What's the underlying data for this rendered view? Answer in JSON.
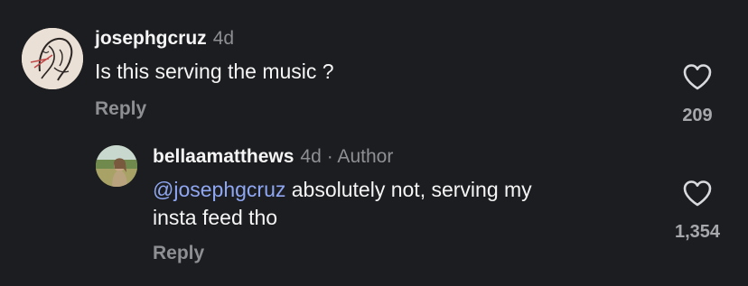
{
  "comments": [
    {
      "username": "josephgcruz",
      "time": "4d",
      "author_tag": "",
      "mention": "",
      "text": "Is this serving the music ?",
      "reply_label": "Reply",
      "likes": "209"
    },
    {
      "username": "bellaamatthews",
      "time": "4d",
      "author_tag": "· Author",
      "mention": "@josephgcruz",
      "text_line1": " absolutely not, serving my",
      "text_line2": "insta feed tho",
      "reply_label": "Reply",
      "likes": "1,354"
    }
  ],
  "colors": {
    "background": "#1c1d20",
    "mention": "#8fa7f3",
    "muted": "#8e8f93"
  },
  "icons": [
    "avatar-sketch",
    "avatar-photo",
    "heart-outline-icon"
  ]
}
